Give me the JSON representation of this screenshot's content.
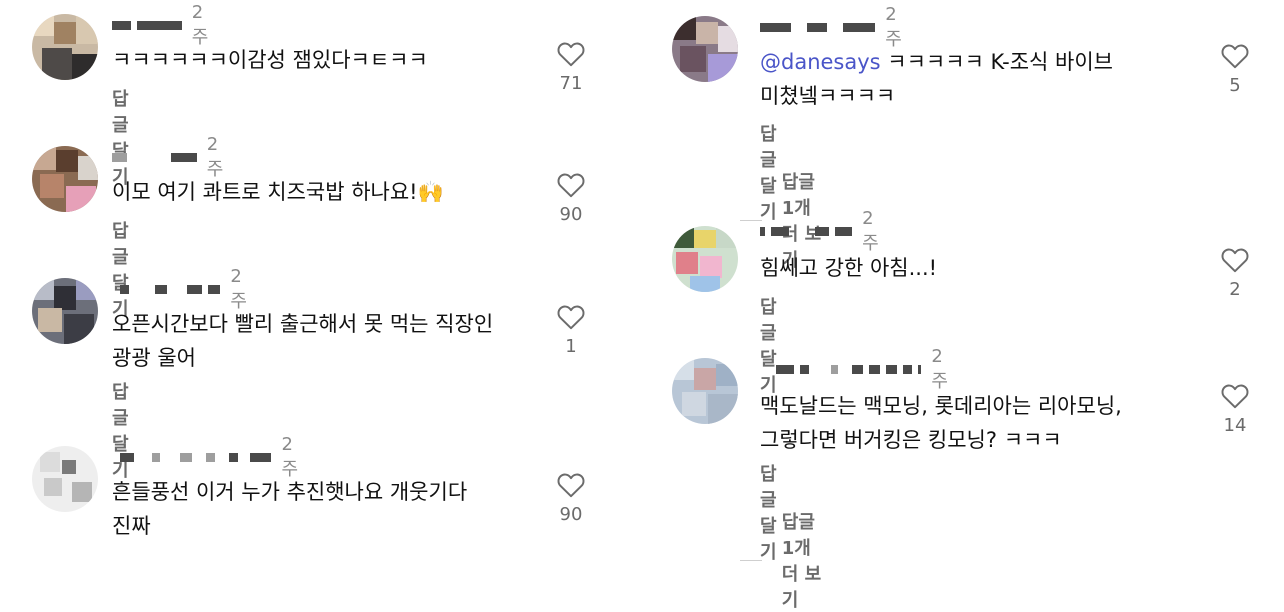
{
  "reply_label": "답글 달기",
  "more_replies_label": "답글 1개 더 보기",
  "left_comments": [
    {
      "time": "2주",
      "text": "ㅋㅋㅋㅋㅋㅋ이감성 잼있다ㅋㅌㅋㅋ",
      "likes": "71"
    },
    {
      "time": "2주",
      "text": "이모 여기 콰트로 치즈국밥 하나요!🙌",
      "likes": "90"
    },
    {
      "time": "2주",
      "text": "오픈시간보다 빨리 출근해서 못 먹는 직장인\n광광 울어",
      "likes": "1"
    },
    {
      "time": "2주",
      "text": "흔들풍선 이거 누가 추진햇나요 개웃기다\n진짜",
      "likes": "90"
    }
  ],
  "right_comments": [
    {
      "time": "2주",
      "mention": "@danesays",
      "text": " ㅋㅋㅋㅋㅋ  K-조식 바이브\n미쳤넼ㅋㅋㅋㅋ",
      "likes": "5"
    },
    {
      "time": "2주",
      "text": "힘쎄고 강한 아침...!",
      "likes": "2"
    },
    {
      "time": "2주",
      "text": "맥도날드는 맥모닝, 롯데리아는 리아모닝,\n그렇다면 버거킹은 킹모닝? ㅋㅋㅋ",
      "likes": "14"
    }
  ]
}
